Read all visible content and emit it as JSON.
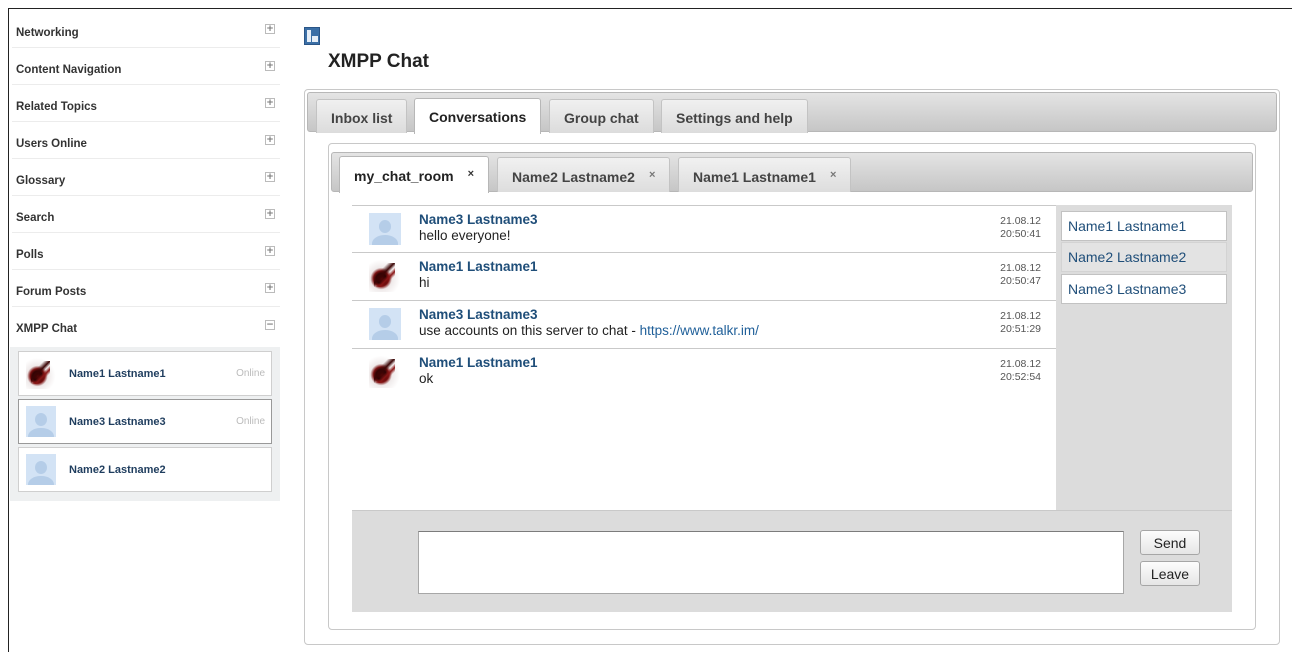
{
  "sidebar": {
    "blocks": [
      {
        "title": "Networking",
        "toggle": "+"
      },
      {
        "title": "Content Navigation",
        "toggle": "+"
      },
      {
        "title": "Related Topics",
        "toggle": "+"
      },
      {
        "title": "Users Online",
        "toggle": "+"
      },
      {
        "title": "Glossary",
        "toggle": "+"
      },
      {
        "title": "Search",
        "toggle": "+"
      },
      {
        "title": "Polls",
        "toggle": "+"
      },
      {
        "title": "Forum Posts",
        "toggle": "+"
      },
      {
        "title": "XMPP Chat",
        "toggle": "−"
      }
    ],
    "contacts": [
      {
        "name": "Name1 Lastname1",
        "status": "Online",
        "avatar": "art-avatar"
      },
      {
        "name": "Name3 Lastname3",
        "status": "Online",
        "avatar": "default-avatar"
      },
      {
        "name": "Name2 Lastname2",
        "status": "",
        "avatar": "default-avatar"
      }
    ]
  },
  "page": {
    "title": "XMPP Chat",
    "icon": "panel-icon"
  },
  "tabs": [
    "Inbox list",
    "Conversations",
    "Group chat",
    "Settings and help"
  ],
  "active_tab": "Conversations",
  "conversation_tabs": [
    {
      "label": "my_chat_room",
      "close": "×"
    },
    {
      "label": "Name2 Lastname2",
      "close": "×"
    },
    {
      "label": "Name1 Lastname1",
      "close": "×"
    }
  ],
  "active_conversation": "my_chat_room",
  "messages": [
    {
      "author": "Name3 Lastname3",
      "text": "hello everyone!",
      "link": "",
      "date": "21.08.12",
      "time": "20:50:41",
      "avatar": "default-avatar"
    },
    {
      "author": "Name1 Lastname1",
      "text": "hi",
      "link": "",
      "date": "21.08.12",
      "time": "20:50:47",
      "avatar": "art-avatar"
    },
    {
      "author": "Name3 Lastname3",
      "text": "use accounts on this server to chat - ",
      "link": "https://www.talkr.im/",
      "date": "21.08.12",
      "time": "20:51:29",
      "avatar": "default-avatar"
    },
    {
      "author": "Name1 Lastname1",
      "text": "ok",
      "link": "",
      "date": "21.08.12",
      "time": "20:52:54",
      "avatar": "art-avatar"
    }
  ],
  "occupants": [
    "Name1 Lastname1",
    "Name2 Lastname2",
    "Name3 Lastname3"
  ],
  "compose": {
    "message_value": "",
    "send_label": "Send",
    "leave_label": "Leave"
  },
  "colors": {
    "link": "#1f4e79",
    "tabbar": "#d0d0d0",
    "compose_bg": "#dcdcdc"
  }
}
